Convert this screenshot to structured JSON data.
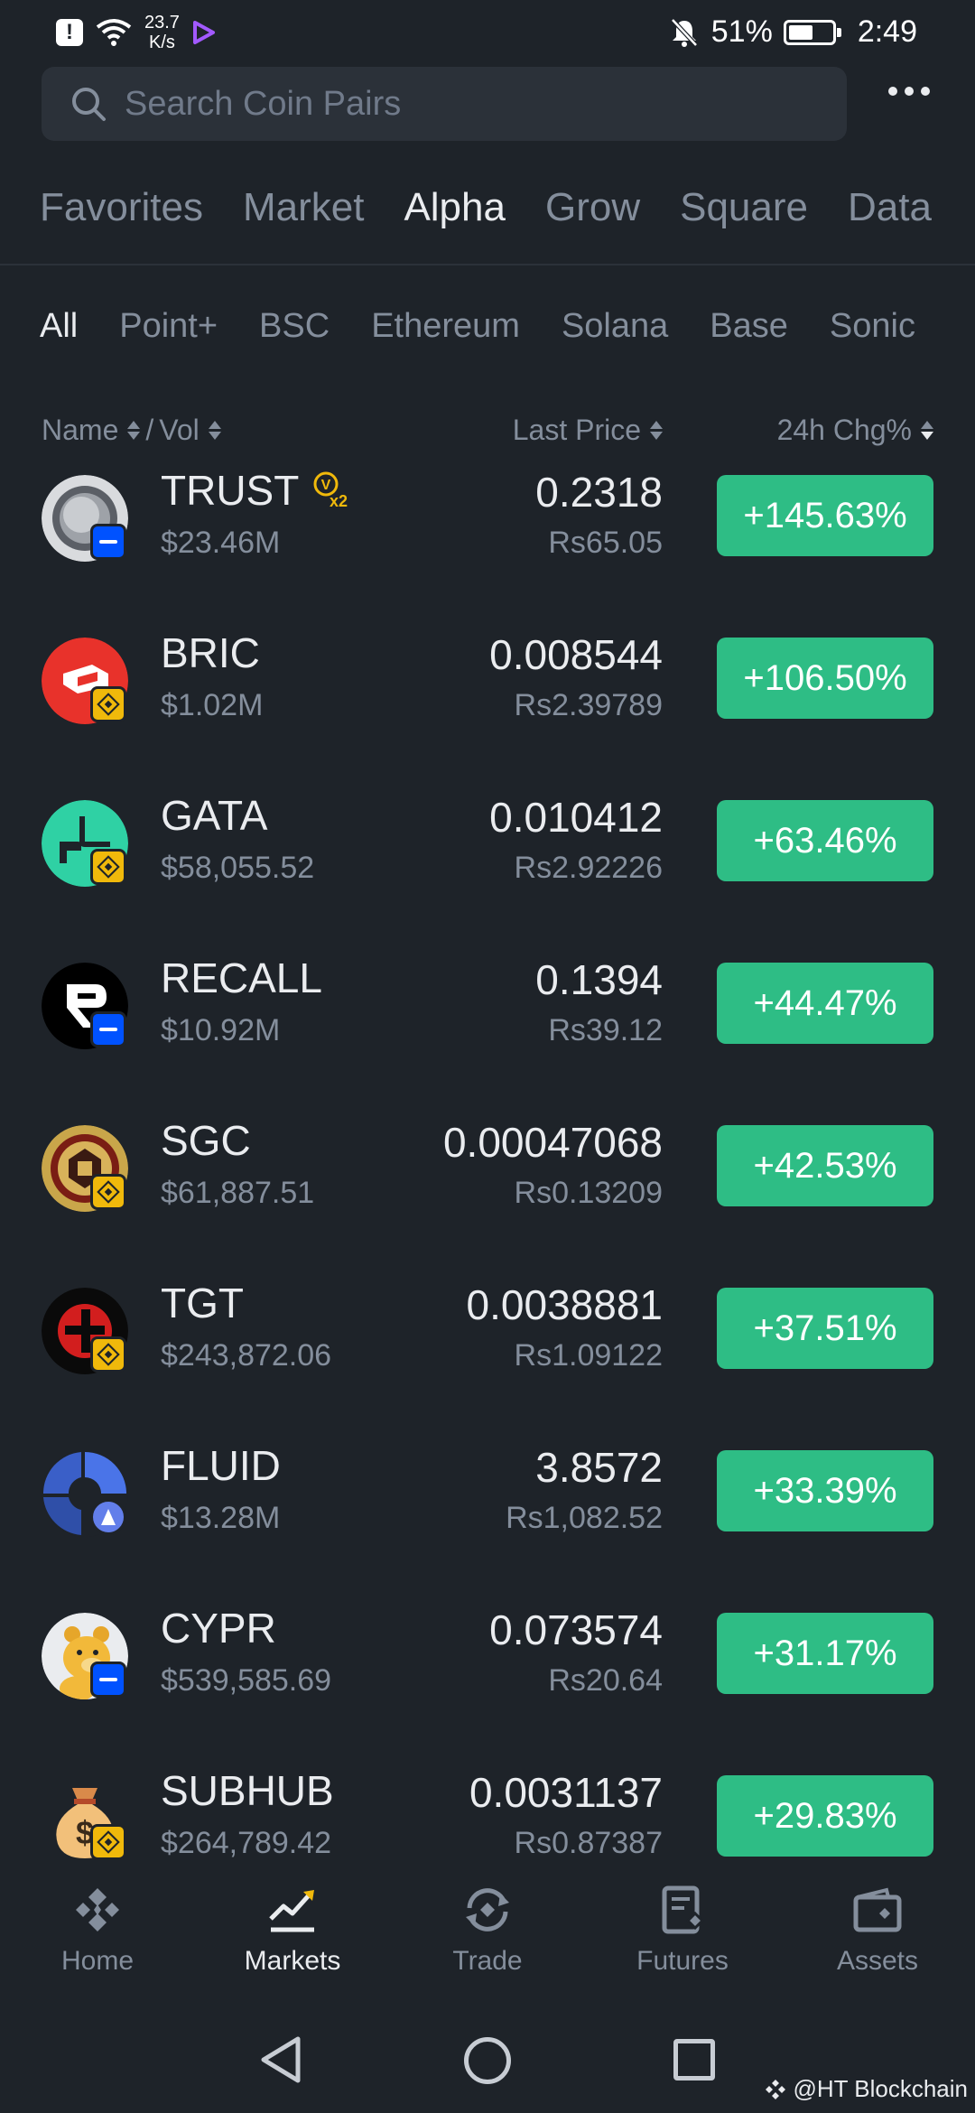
{
  "status_bar": {
    "net_speed_value": "23.7",
    "net_speed_unit": "K/s",
    "battery": "51%",
    "time": "2:49"
  },
  "search": {
    "placeholder": "Search Coin Pairs"
  },
  "main_tabs": [
    "Favorites",
    "Market",
    "Alpha",
    "Grow",
    "Square",
    "Data"
  ],
  "main_tab_active": "Alpha",
  "sub_tabs": [
    "All",
    "Point+",
    "BSC",
    "Ethereum",
    "Solana",
    "Base",
    "Sonic"
  ],
  "sub_tab_active": "All",
  "columns": {
    "name": "Name",
    "separator": "/",
    "vol": "Vol",
    "last_price": "Last Price",
    "change": "24h Chg%"
  },
  "coins": [
    {
      "symbol": "TRUST",
      "volume": "$23.46M",
      "price": "0.2318",
      "fiat": "Rs65.05",
      "change": "+145.63%",
      "chain": "base-icon",
      "logo": "trust-logo-icon",
      "boost": "x2"
    },
    {
      "symbol": "BRIC",
      "volume": "$1.02M",
      "price": "0.008544",
      "fiat": "Rs2.39789",
      "change": "+106.50%",
      "chain": "bsc-icon",
      "logo": "bric-logo-icon"
    },
    {
      "symbol": "GATA",
      "volume": "$58,055.52",
      "price": "0.010412",
      "fiat": "Rs2.92226",
      "change": "+63.46%",
      "chain": "bsc-icon",
      "logo": "gata-logo-icon"
    },
    {
      "symbol": "RECALL",
      "volume": "$10.92M",
      "price": "0.1394",
      "fiat": "Rs39.12",
      "change": "+44.47%",
      "chain": "base-icon",
      "logo": "recall-logo-icon"
    },
    {
      "symbol": "SGC",
      "volume": "$61,887.51",
      "price": "0.00047068",
      "fiat": "Rs0.13209",
      "change": "+42.53%",
      "chain": "bsc-icon",
      "logo": "sgc-logo-icon"
    },
    {
      "symbol": "TGT",
      "volume": "$243,872.06",
      "price": "0.0038881",
      "fiat": "Rs1.09122",
      "change": "+37.51%",
      "chain": "bsc-icon",
      "logo": "tgt-logo-icon"
    },
    {
      "symbol": "FLUID",
      "volume": "$13.28M",
      "price": "3.8572",
      "fiat": "Rs1,082.52",
      "change": "+33.39%",
      "chain": "ethereum-icon",
      "logo": "fluid-logo-icon"
    },
    {
      "symbol": "CYPR",
      "volume": "$539,585.69",
      "price": "0.073574",
      "fiat": "Rs20.64",
      "change": "+31.17%",
      "chain": "base-icon",
      "logo": "cypr-logo-icon"
    },
    {
      "symbol": "SUBHUB",
      "volume": "$264,789.42",
      "price": "0.0031137",
      "fiat": "Rs0.87387",
      "change": "+29.83%",
      "chain": "bsc-icon",
      "logo": "subhub-logo-icon"
    }
  ],
  "bottom_nav": [
    {
      "label": "Home",
      "icon": "home-icon"
    },
    {
      "label": "Markets",
      "icon": "markets-icon",
      "active": true
    },
    {
      "label": "Trade",
      "icon": "trade-icon"
    },
    {
      "label": "Futures",
      "icon": "futures-icon"
    },
    {
      "label": "Assets",
      "icon": "assets-icon"
    }
  ],
  "watermark": "@HT Blockchain",
  "colors": {
    "background": "#1e2329",
    "accent": "#f0b90b",
    "positive": "#2ebd85",
    "muted": "#848e9c"
  }
}
